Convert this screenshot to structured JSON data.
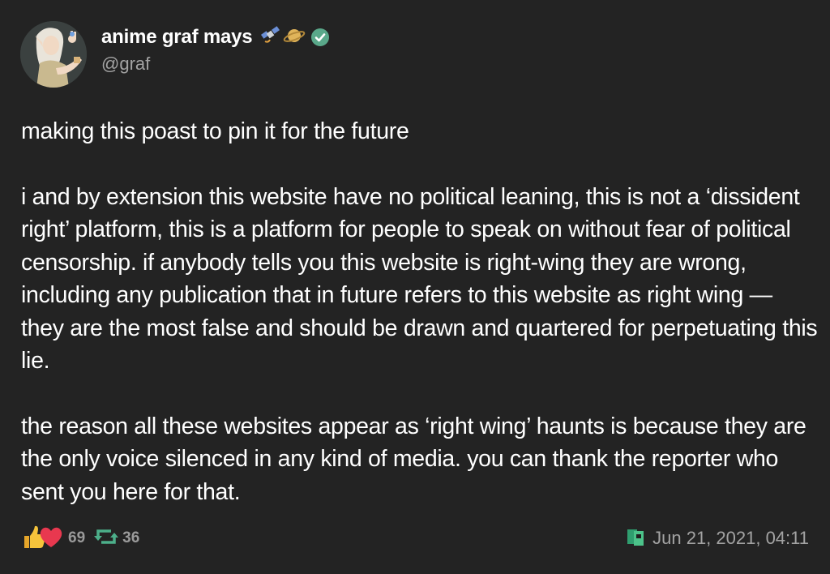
{
  "author": {
    "display_name": "anime graf mays",
    "handle": "@graf",
    "emoji": [
      "satellite-emoji",
      "ringed-planet-emoji"
    ],
    "verified": true,
    "verified_color": "#4caf8a"
  },
  "post": {
    "paragraphs": [
      "making this poast to pin it for the future",
      "i and by extension this website have no political leaning, this is not a ‘dissident right’ platform, this is a platform for people to speak on without fear of political censorship. if anybody tells you this website is right-wing they are wrong, including any publication that in future refers to this website as right wing — they are the most false and should be drawn and quartered for perpetuating this lie.",
      "the reason all these websites appear as ‘right wing’ haunts is because they are the only voice silenced in any kind of media. you can thank the reporter who sent you here for that."
    ]
  },
  "footer": {
    "reactions_count": "69",
    "reposts_count": "36",
    "timestamp": "Jun 21, 2021, 04:11",
    "icons": {
      "reactions": [
        "thumbs-up-icon",
        "heart-icon"
      ],
      "repost": "repost-icon",
      "source": "poa-source-icon"
    },
    "colors": {
      "repost": "#4caf8a",
      "heart": "#e8384f",
      "thumb": "#f5c33b"
    }
  }
}
